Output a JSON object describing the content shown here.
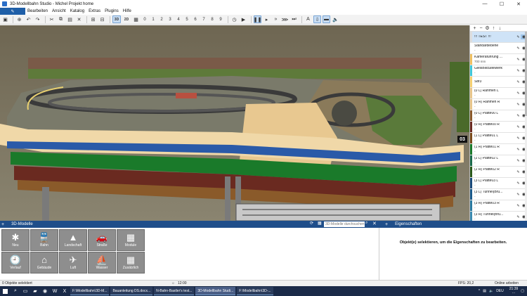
{
  "window": {
    "title": "3D-Modellbahn Studio - Michel Projekt home",
    "controls": {
      "minimize": "—",
      "maximize": "☐",
      "close": "✕"
    }
  },
  "menu": {
    "items": [
      "Bearbeiten",
      "Ansicht",
      "Katalog",
      "Extras",
      "Plugins",
      "Hilfe"
    ]
  },
  "toolbar": {
    "view_3d": "3D",
    "view_2d": "2D",
    "layer_numbers": [
      "0",
      "1",
      "2",
      "3",
      "4",
      "5",
      "6",
      "7",
      "8",
      "9"
    ]
  },
  "layers": [
    {
      "name": "!!! TEST !!!",
      "sub": "",
      "color": "#dddddd"
    },
    {
      "name": "Standardebene",
      "sub": "-",
      "color": "#ffffff"
    },
    {
      "name": "Kameraführung ...",
      "sub": "700 mm",
      "color": "#f0c060"
    },
    {
      "name": "GleisBildStellwerk",
      "sub": "-",
      "color": "#40c8d8"
    },
    {
      "name": "Sbf3",
      "sub": "",
      "color": "#f5d070"
    },
    {
      "name": "(0 L) Rahmen L",
      "sub": "-",
      "color": "#e8c68a"
    },
    {
      "name": "(0 R) Rahmen R",
      "sub": "-",
      "color": "#e8c68a"
    },
    {
      "name": "(0 L) Platte00 L",
      "sub": "-",
      "color": "#8a5a2a"
    },
    {
      "name": "(0 R) Platte00 R",
      "sub": "-",
      "color": "#6a2a20"
    },
    {
      "name": "(1 L) Platte01 L",
      "sub": "-",
      "color": "#7a4a1a"
    },
    {
      "name": "(1 R) Platte01 R",
      "sub": "-",
      "color": "#1a7a2a"
    },
    {
      "name": "(2 L) Platte02 L",
      "sub": "-",
      "color": "#1a6a4a"
    },
    {
      "name": "(2 R) Platte02 R",
      "sub": "-",
      "color": "#2a5a1a"
    },
    {
      "name": "(3 L) Platte03 L",
      "sub": "-",
      "color": "#1a4a7a"
    },
    {
      "name": "(3 L) Tunnel(Brü...",
      "sub": "-",
      "color": "#1a5a8a"
    },
    {
      "name": "(3 R) Platte03 R",
      "sub": "-",
      "color": "#2a7aa0"
    },
    {
      "name": "(3 R) Tunnel(Brü...",
      "sub": "-",
      "color": "#3a8ab0"
    }
  ],
  "viewport": {
    "overlay_label": "03"
  },
  "models_panel": {
    "title": "3D-Modelle",
    "search_placeholder": "3D-Modelle durchsuchen",
    "tiles": [
      {
        "label": "Neu",
        "icon": "✱"
      },
      {
        "label": "Bahn",
        "icon": "🚆"
      },
      {
        "label": "Landschaft",
        "icon": "▲"
      },
      {
        "label": "Straße",
        "icon": "🚗"
      },
      {
        "label": "Module",
        "icon": "▦"
      },
      {
        "label": "Verlauf",
        "icon": "🕘"
      },
      {
        "label": "Gebäude",
        "icon": "⌂"
      },
      {
        "label": "Luft",
        "icon": "✈"
      },
      {
        "label": "Wasser",
        "icon": "⛵"
      },
      {
        "label": "Zusätzlich",
        "icon": "▦"
      }
    ]
  },
  "properties_panel": {
    "title": "Eigenschaften",
    "message": "Objekt(e) selektieren, um die Eigenschaften zu bearbeiten."
  },
  "status": {
    "selection": "0 Objekte selektiert",
    "time": "12:00",
    "fps": "FPS: 20,2",
    "online": "Online arbeiten"
  },
  "taskbar": {
    "tasks": [
      "F:\\Modellbahn\\3D-M...",
      "Bauanleitung DS.docx...",
      "N-Bahn-Bastler's test...",
      "3D-Modellbahn Studi...",
      "F:\\Modellbahn\\3D-..."
    ],
    "language": "DEU",
    "clock_time": "21:39",
    "clock_date": "..."
  },
  "colors": {
    "accent": "#1f4e8a",
    "active_tab": "#1f5fa8",
    "tile": "#8e8e8e"
  }
}
